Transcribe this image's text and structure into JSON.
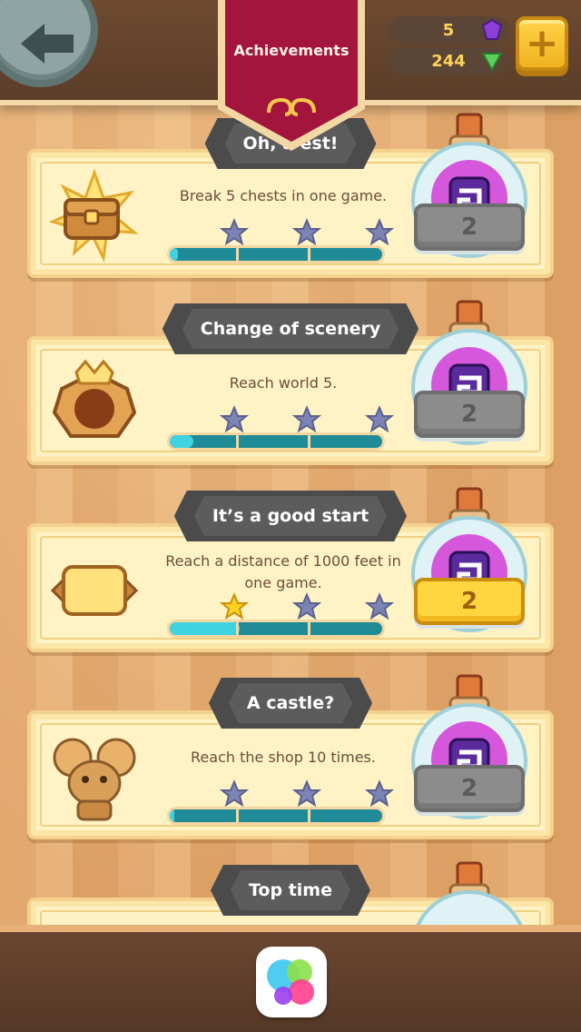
{
  "header": {
    "title": "Achievements",
    "gems": "5",
    "coins": "244",
    "back_icon": "back-arrow-icon",
    "add_icon": "plus-icon"
  },
  "achievements": [
    {
      "title": "Oh, a chest!",
      "title_visible": "Oh, a   est!",
      "description": "Break 5 chests in one game.",
      "stars_earned": 0,
      "progress_fraction": 0.04,
      "reward": "2",
      "reward_style": "grey",
      "icon": "chest-icon"
    },
    {
      "title": "Change of scenery",
      "description": "Reach world 5.",
      "stars_earned": 0,
      "progress_fraction": 0.11,
      "reward": "2",
      "reward_style": "grey",
      "icon": "crown-emblem-icon"
    },
    {
      "title": "It’s a good start",
      "description": "Reach a distance of 1000 feet in one game.",
      "stars_earned": 1,
      "progress_fraction": 0.33,
      "reward": "2",
      "reward_style": "gold",
      "icon": "scroll-sign-icon"
    },
    {
      "title": "A castle?",
      "description": "Reach the shop 10 times.",
      "stars_earned": 0,
      "progress_fraction": 0.02,
      "reward": "2",
      "reward_style": "grey",
      "icon": "mouse-icon"
    },
    {
      "title": "Top time",
      "description": "",
      "reward_style": "grey",
      "icon": "potion-icon"
    }
  ],
  "colors": {
    "banner": "#a3153d",
    "card_bg": "#fff3c6",
    "progress_fill": "#3fd3e2",
    "progress_track": "#1f8b97",
    "star_empty": "#7b84b5",
    "star_earned": "#ffd21f"
  },
  "footer": {
    "game_center_icon": "game-center-icon"
  }
}
